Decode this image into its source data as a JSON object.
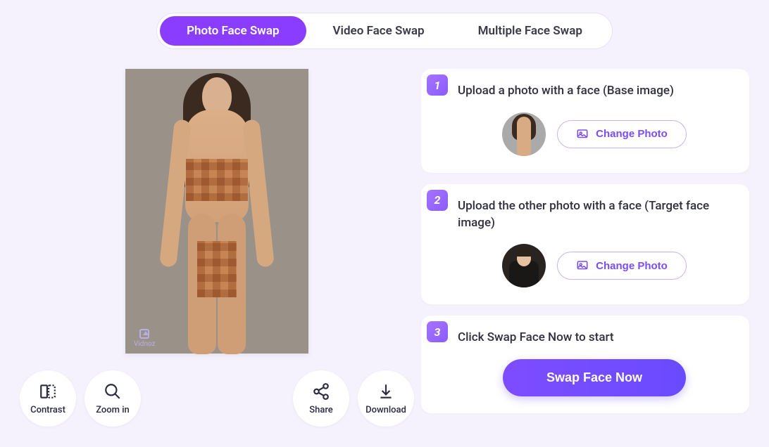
{
  "tabs": {
    "photo": "Photo Face Swap",
    "video": "Video Face Swap",
    "multiple": "Multiple Face Swap"
  },
  "watermark": "Vidnoz",
  "actions": {
    "contrast": "Contrast",
    "zoomin": "Zoom in",
    "share": "Share",
    "download": "Download"
  },
  "steps": {
    "s1": {
      "num": "1",
      "title": "Upload a photo with a face (Base image)",
      "change": "Change Photo"
    },
    "s2": {
      "num": "2",
      "title": "Upload the other photo with a face (Target face image)",
      "change": "Change Photo"
    },
    "s3": {
      "num": "3",
      "title": "Click Swap Face Now to start",
      "cta": "Swap Face Now"
    }
  }
}
